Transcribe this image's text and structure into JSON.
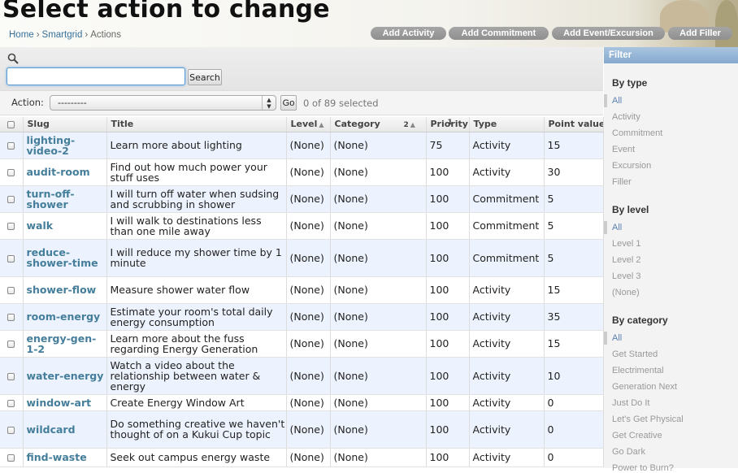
{
  "page_title": "Select action to change",
  "breadcrumb": [
    "Home",
    "Smartgrid",
    "Actions"
  ],
  "tools": [
    "Add Activity",
    "Add Commitment",
    "Add Event/Excursion",
    "Add Filler"
  ],
  "search": {
    "button": "Search",
    "value": ""
  },
  "actions": {
    "label": "Action:",
    "selected": "---------",
    "go": "Go",
    "count": "0 of 89 selected"
  },
  "table": {
    "headers": {
      "slug": "Slug",
      "title": "Title",
      "level": "Level",
      "category": "Category",
      "category_sort": "2",
      "priority": "Priority",
      "priority_sort": "1",
      "type": "Type",
      "point_value": "Point value"
    },
    "rows": [
      {
        "slug": "lighting-video-2",
        "title": "Learn more about lighting",
        "level": "(None)",
        "category": "(None)",
        "priority": "75",
        "type": "Activity",
        "points": "15"
      },
      {
        "slug": "audit-room",
        "title": "Find out how much power your stuff uses",
        "level": "(None)",
        "category": "(None)",
        "priority": "100",
        "type": "Activity",
        "points": "30"
      },
      {
        "slug": "turn-off-shower",
        "title": "I will turn off water when sudsing and scrubbing in shower",
        "level": "(None)",
        "category": "(None)",
        "priority": "100",
        "type": "Commitment",
        "points": "5"
      },
      {
        "slug": "walk",
        "title": "I will walk to destinations less than one mile away",
        "level": "(None)",
        "category": "(None)",
        "priority": "100",
        "type": "Commitment",
        "points": "5"
      },
      {
        "slug": "reduce-shower-time",
        "title": "I will reduce my shower time by 1 minute",
        "level": "(None)",
        "category": "(None)",
        "priority": "100",
        "type": "Commitment",
        "points": "5"
      },
      {
        "slug": "shower-flow",
        "title": "Measure shower water flow",
        "level": "(None)",
        "category": "(None)",
        "priority": "100",
        "type": "Activity",
        "points": "15"
      },
      {
        "slug": "room-energy",
        "title": "Estimate your room's total daily energy consumption",
        "level": "(None)",
        "category": "(None)",
        "priority": "100",
        "type": "Activity",
        "points": "35"
      },
      {
        "slug": "energy-gen-1-2",
        "title": "Learn more about the fuss regarding Energy Generation",
        "level": "(None)",
        "category": "(None)",
        "priority": "100",
        "type": "Activity",
        "points": "15"
      },
      {
        "slug": "water-energy",
        "title": "Watch a video about the relationship between water & energy",
        "level": "(None)",
        "category": "(None)",
        "priority": "100",
        "type": "Activity",
        "points": "10"
      },
      {
        "slug": "window-art",
        "title": "Create Energy Window Art",
        "level": "(None)",
        "category": "(None)",
        "priority": "100",
        "type": "Activity",
        "points": "0"
      },
      {
        "slug": "wildcard",
        "title": "Do something creative we haven't thought of on a Kukui Cup topic",
        "level": "(None)",
        "category": "(None)",
        "priority": "100",
        "type": "Activity",
        "points": "0"
      },
      {
        "slug": "find-waste",
        "title": "Seek out campus energy waste",
        "level": "(None)",
        "category": "(None)",
        "priority": "100",
        "type": "Activity",
        "points": "0"
      }
    ]
  },
  "filter": {
    "title": "Filter",
    "by_type": {
      "heading": "By type",
      "options": [
        "All",
        "Activity",
        "Commitment",
        "Event",
        "Excursion",
        "Filler"
      ]
    },
    "by_level": {
      "heading": "By level",
      "options": [
        "All",
        "Level 1",
        "Level 2",
        "Level 3",
        "(None)"
      ]
    },
    "by_category": {
      "heading": "By category",
      "options": [
        "All",
        "Get Started",
        "Electrimental",
        "Generation Next",
        "Just Do It",
        "Let's Get Physical",
        "Get Creative",
        "Go Dark",
        "Power to Burn?"
      ]
    }
  },
  "colors": {
    "link": "#447e9b",
    "filter_header": "#85a9cf",
    "row_alt": "#edf3fe",
    "tool_button": "#999999"
  }
}
